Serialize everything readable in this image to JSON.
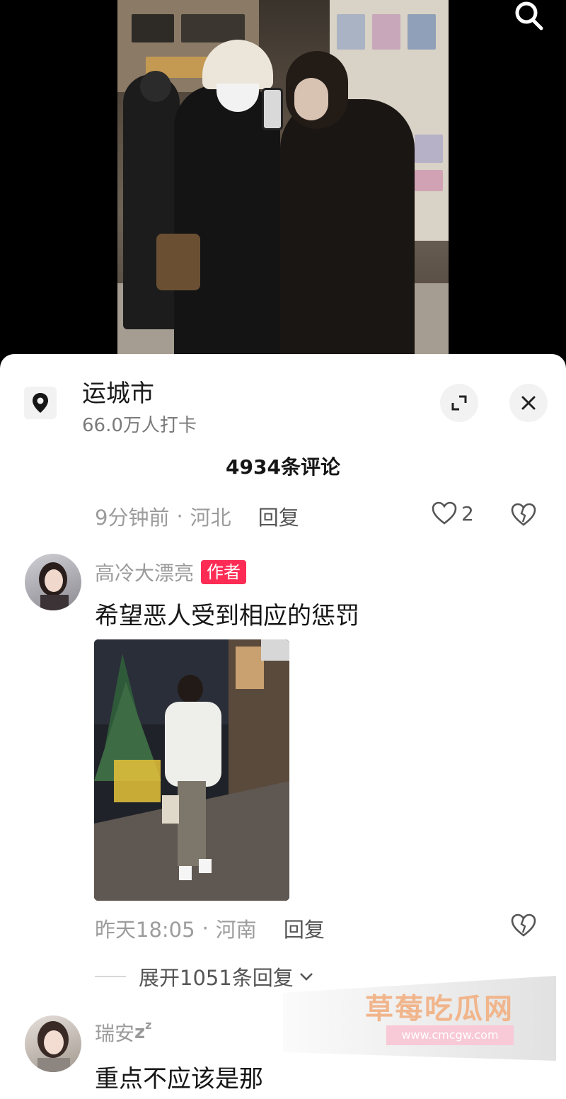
{
  "header": {
    "search_icon": "search-icon"
  },
  "location": {
    "name": "运城市",
    "checkins": "66.0万人打卡",
    "icon": "location-pin-icon"
  },
  "sheet": {
    "comment_count": "4934条评论",
    "expand_icon": "expand-icon",
    "close_icon": "close-icon"
  },
  "comments": [
    {
      "time": "9分钟前",
      "separator": "·",
      "region": "河北",
      "reply_label": "回复",
      "likes": "2"
    },
    {
      "username": "高冷大漂亮",
      "badge": "作者",
      "text": "希望恶人受到相应的惩罚",
      "time": "昨天18:05",
      "separator": "·",
      "region": "河南",
      "reply_label": "回复",
      "expand_replies": "展开1051条回复"
    },
    {
      "username": "瑞安",
      "username_suffix": "z",
      "username_suffix_small": "z",
      "text": "重点不应该是那"
    }
  ],
  "watermark": {
    "title": "草莓吃瓜网",
    "url": "www.cmcgw.com"
  },
  "colors": {
    "author_badge": "#fe2c55",
    "meta_text": "#9c9c9c"
  }
}
